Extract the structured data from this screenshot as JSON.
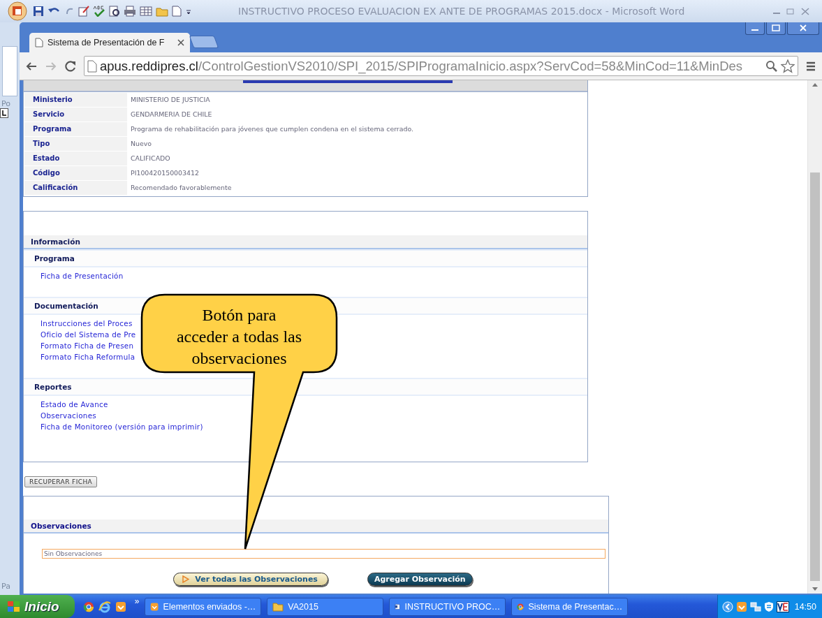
{
  "word_window": {
    "title": "INSTRUCTIVO PROCESO EVALUACION EX ANTE DE PROGRAMAS 2015.docx - Microsoft Word",
    "side_labels": [
      "Po",
      "Pa"
    ]
  },
  "browser": {
    "tabs": [
      {
        "label": "Sistema de Presentación de F",
        "selected": true
      }
    ],
    "url": {
      "host": "apus.reddipres.cl",
      "path": "/ControlGestionVS2010/SPI_2015/SPIProgramaInicio.aspx?ServCod=58&MinCod=11&MinDes"
    }
  },
  "summary": {
    "rows": [
      {
        "label": "Ministerio",
        "value": "MINISTERIO DE JUSTICIA"
      },
      {
        "label": "Servicio",
        "value": "GENDARMERIA DE CHILE"
      },
      {
        "label": "Programa",
        "value": "Programa de rehabilitación para jóvenes que cumplen condena en el sistema cerrado."
      },
      {
        "label": "Tipo",
        "value": "Nuevo"
      },
      {
        "label": "Estado",
        "value": "CALIFICADO"
      },
      {
        "label": "Código",
        "value": "PI100420150003412"
      },
      {
        "label": "Calificación",
        "value": "Recomendado favorablemente"
      }
    ]
  },
  "information": {
    "title": "Información",
    "sections": [
      {
        "title": "Programa",
        "links": [
          "Ficha de Presentación"
        ]
      },
      {
        "title": "Documentación",
        "links": [
          "Instrucciones del Proces",
          "Oficio del Sistema de Pre",
          "Formato Ficha de Presen",
          "Formato Ficha Reformula"
        ]
      },
      {
        "title": "Reportes",
        "links": [
          "Estado de Avance",
          "Observaciones",
          "Ficha de Monitoreo (versión para imprimir)"
        ]
      }
    ]
  },
  "recover_button": "RECUPERAR FICHA",
  "observations": {
    "title": "Observaciones",
    "field_value": "Sin Observaciones",
    "buttons": [
      {
        "kind": "secondary",
        "label": "Ver todas las Observaciones"
      },
      {
        "kind": "primary",
        "label": "Agregar Observación"
      }
    ]
  },
  "callout": {
    "lines": [
      "Botón para",
      "acceder a todas las",
      "observaciones"
    ]
  },
  "taskbar": {
    "start": "Inicio",
    "overflow": "»",
    "tasks": [
      {
        "kind": "mail",
        "label": "Elementos enviados -…"
      },
      {
        "kind": "folder",
        "label": "VA2015"
      },
      {
        "kind": "document",
        "label": "INSTRUCTIVO PROC…"
      },
      {
        "kind": "browser",
        "label": "Sistema de Presentac…"
      }
    ],
    "clock": "14:50"
  }
}
